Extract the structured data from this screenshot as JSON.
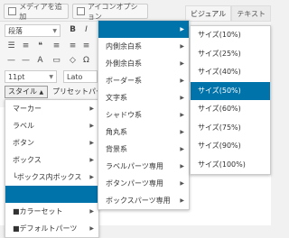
{
  "top_buttons": {
    "add_media": "メディアを追加",
    "icon_option": "アイコンオプション"
  },
  "tabs": {
    "visual": "ビジュアル",
    "text": "テキスト"
  },
  "toolbar": {
    "format_select": "段落",
    "bold": "B",
    "italic": "I",
    "font_size": "11pt",
    "font_family": "Lato",
    "style_button": "スタイル",
    "preset_button": "プリセットパー"
  },
  "style_menu": [
    {
      "label": "マーカー",
      "has_sub": true
    },
    {
      "label": "ラベル",
      "has_sub": true
    },
    {
      "label": "ボタン",
      "has_sub": true
    },
    {
      "label": "ボックス",
      "has_sub": true
    },
    {
      "label": "└ボックス内ボックス",
      "has_sub": true
    },
    {
      "label": "",
      "has_sub": false
    },
    {
      "label": "■カラーセット",
      "has_sub": true
    },
    {
      "label": "■デフォルトパーツ",
      "has_sub": true
    }
  ],
  "submenu_1": [
    {
      "label": "",
      "has_sub": true
    },
    {
      "label": "内側余白系",
      "has_sub": true
    },
    {
      "label": "外側余白系",
      "has_sub": true
    },
    {
      "label": "ボーダー系",
      "has_sub": true
    },
    {
      "label": "文字系",
      "has_sub": true
    },
    {
      "label": "シャドウ系",
      "has_sub": true
    },
    {
      "label": "角丸系",
      "has_sub": true
    },
    {
      "label": "背景系",
      "has_sub": true
    },
    {
      "label": "ラベルパーツ専用",
      "has_sub": true
    },
    {
      "label": "ボタンパーツ専用",
      "has_sub": true
    },
    {
      "label": "ボックスパーツ専用",
      "has_sub": true
    }
  ],
  "submenu_2": [
    {
      "label": "サイズ(10%)"
    },
    {
      "label": "サイズ(25%)"
    },
    {
      "label": "サイズ(40%)"
    },
    {
      "label": "サイズ(50%)"
    },
    {
      "label": "サイズ(60%)"
    },
    {
      "label": "サイズ(75%)"
    },
    {
      "label": "サイズ(90%)"
    },
    {
      "label": "サイズ(100%)"
    }
  ],
  "colors": {
    "highlight": "#0073aa"
  }
}
